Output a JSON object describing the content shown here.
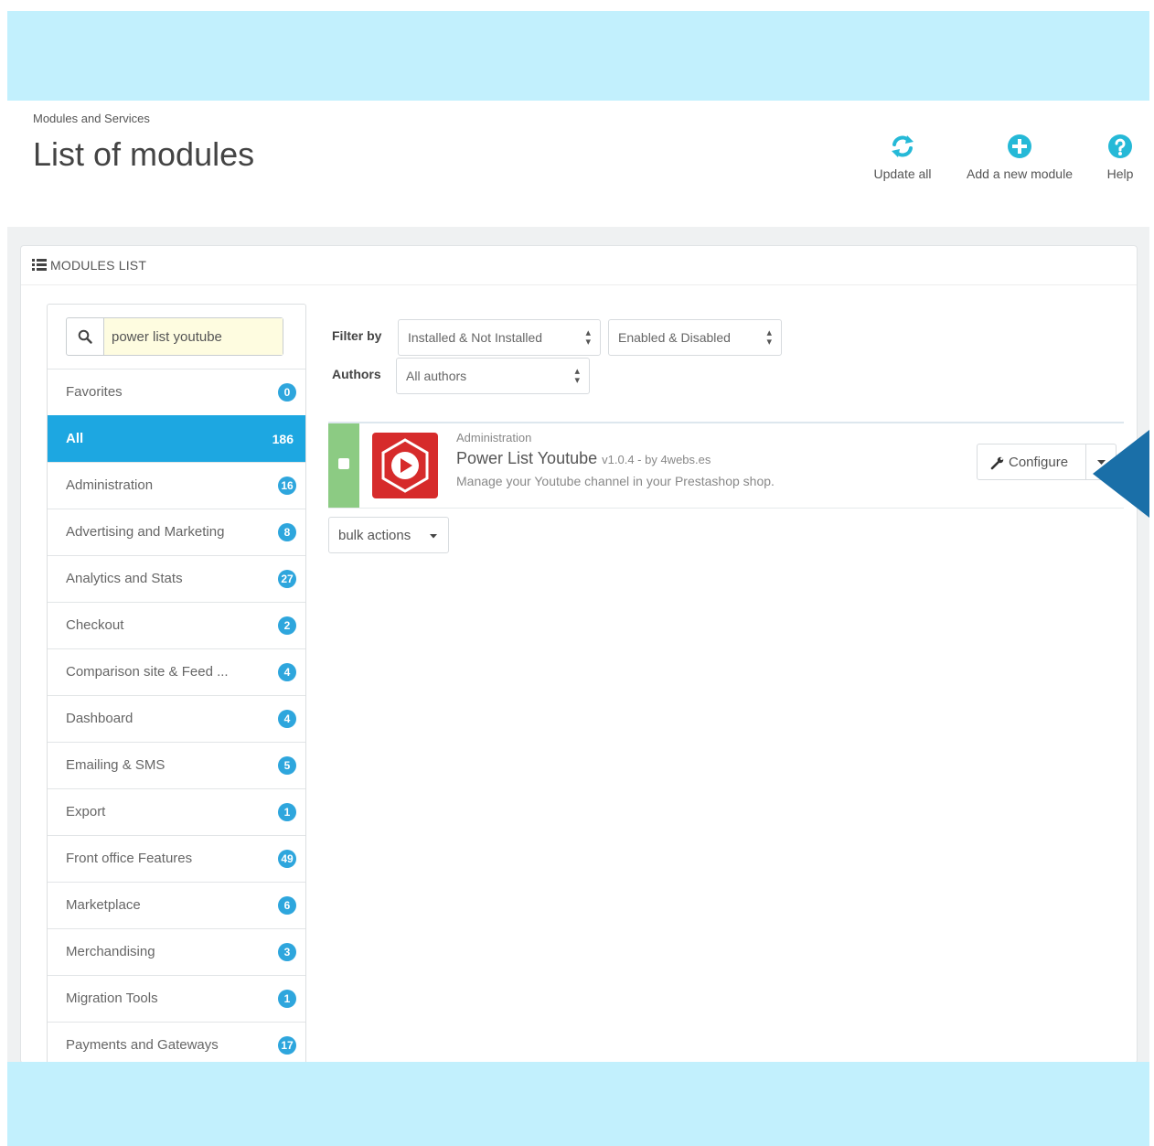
{
  "header": {
    "breadcrumb": "Modules and Services",
    "title": "List of modules",
    "toolbar": [
      {
        "label": "Update all",
        "icon": "refresh-icon"
      },
      {
        "label": "Add a new module",
        "icon": "plus-circle-icon"
      },
      {
        "label": "Help",
        "icon": "question-circle-icon"
      }
    ]
  },
  "panel": {
    "heading": "MODULES LIST",
    "heading_icon": "list-icon"
  },
  "sidebar": {
    "search": {
      "value": "power list youtube",
      "icon": "search-icon"
    },
    "categories": [
      {
        "label": "Favorites",
        "count": "0",
        "active": false
      },
      {
        "label": "All",
        "count": "186",
        "active": true
      },
      {
        "label": "Administration",
        "count": "16",
        "active": false
      },
      {
        "label": "Advertising and Marketing",
        "count": "8",
        "active": false
      },
      {
        "label": "Analytics and Stats",
        "count": "27",
        "active": false
      },
      {
        "label": "Checkout",
        "count": "2",
        "active": false
      },
      {
        "label": "Comparison site & Feed ...",
        "count": "4",
        "active": false
      },
      {
        "label": "Dashboard",
        "count": "4",
        "active": false
      },
      {
        "label": "Emailing & SMS",
        "count": "5",
        "active": false
      },
      {
        "label": "Export",
        "count": "1",
        "active": false
      },
      {
        "label": "Front office Features",
        "count": "49",
        "active": false
      },
      {
        "label": "Marketplace",
        "count": "6",
        "active": false
      },
      {
        "label": "Merchandising",
        "count": "3",
        "active": false
      },
      {
        "label": "Migration Tools",
        "count": "1",
        "active": false
      },
      {
        "label": "Payments and Gateways",
        "count": "17",
        "active": false
      }
    ]
  },
  "filters": {
    "filter_by_label": "Filter by",
    "install_select": "Installed & Not Installed",
    "enabled_select": "Enabled & Disabled",
    "authors_label": "Authors",
    "authors_select": "All authors"
  },
  "module": {
    "category": "Administration",
    "name": "Power List Youtube",
    "meta": "v1.0.4 - by 4webs.es",
    "description": "Manage your Youtube channel in your Prestashop shop.",
    "configure_label": "Configure",
    "status_color": "#8ccb83",
    "logo_color": "#d62b2b",
    "logo_icon": "youtube-play-icon"
  },
  "bulk_actions_label": "bulk actions",
  "colors": {
    "accent": "#1da7e1",
    "badge": "#2ea6dd",
    "band": "#c2f0fd",
    "arrow": "#1a6fa8"
  }
}
